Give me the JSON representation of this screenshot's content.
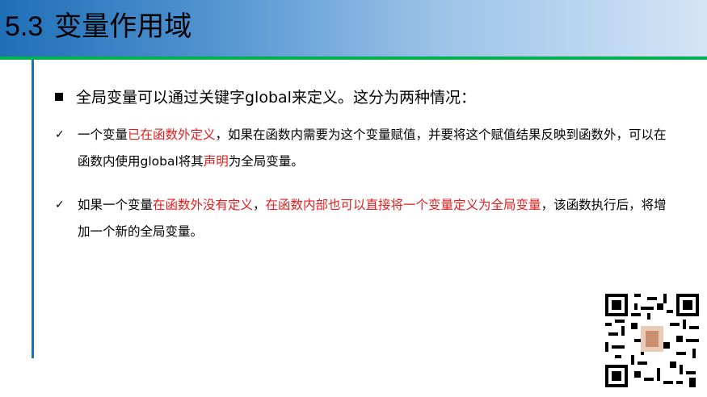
{
  "slide": {
    "section_number": "5.3",
    "title": "变量作用域",
    "main_bullet": "全局变量可以通过关键字global来定义。这分为两种情况：",
    "points": [
      {
        "t1": "一个变量",
        "r1": "已在函数外定义",
        "t2": "，如果在函数内需要为这个变量赋值，并要将这个赋值结果反映到函数外，可以在函数内使用global将其",
        "r2": "声明",
        "t3": "为全局变量。"
      },
      {
        "t1": "如果一个变量",
        "r1": "在函数外没有定义",
        "t2": "，",
        "r2": "在函数内部也可以直接将一个变量定义为全局变量",
        "t3": "，该函数执行后，将增加一个新的全局变量。"
      }
    ]
  },
  "colors": {
    "accent_blue": "#1f6fb7",
    "rule_green": "#00b050",
    "highlight_red": "#e41e1e"
  },
  "icons": {
    "bullet": "square-bullet-icon",
    "check": "checkmark-icon",
    "qr": "qr-code-icon"
  }
}
